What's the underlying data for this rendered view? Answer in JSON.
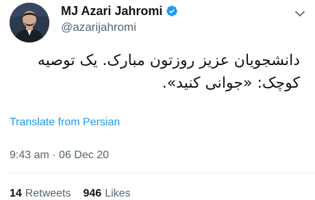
{
  "author": {
    "display_name": "MJ Azari Jahromi",
    "handle": "@azarijahromi",
    "verified": true,
    "avatar_icon": "profile-photo"
  },
  "tweet": {
    "text": "دانشجویان عزیز روزتون مبارک. یک توصیه کوچک: «جوانی کنید».",
    "translate_label": "Translate from Persian",
    "time": "9:43 am",
    "separator": "·",
    "date": "06 Dec 20"
  },
  "stats": {
    "retweets_count": "14",
    "retweets_label": "Retweets",
    "likes_count": "946",
    "likes_label": "Likes"
  },
  "colors": {
    "link": "#1d9bf0",
    "verified": "#1d9bf0",
    "secondary_text": "#536471",
    "primary_text": "#0f1419",
    "divider": "#e6ecf0"
  }
}
